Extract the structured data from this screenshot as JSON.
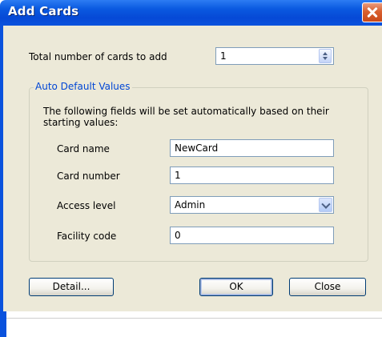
{
  "window": {
    "title": "Add Cards",
    "close_icon": "close-icon"
  },
  "total": {
    "label": "Total number of cards to add",
    "value": "1"
  },
  "group": {
    "legend": "Auto Default Values",
    "description": "The following fields will be set automatically based on their starting values:",
    "fields": {
      "card_name": {
        "label": "Card name",
        "value": "NewCard"
      },
      "card_number": {
        "label": "Card number",
        "value": "1"
      },
      "access_level": {
        "label": "Access level",
        "value": "Admin"
      },
      "facility_code": {
        "label": "Facility code",
        "value": "0"
      }
    }
  },
  "buttons": {
    "detail": "Detail...",
    "ok": "OK",
    "close": "Close"
  },
  "colors": {
    "titlebar": "#0a52dd",
    "legend": "#0046d5",
    "client": "#ece9d8"
  }
}
